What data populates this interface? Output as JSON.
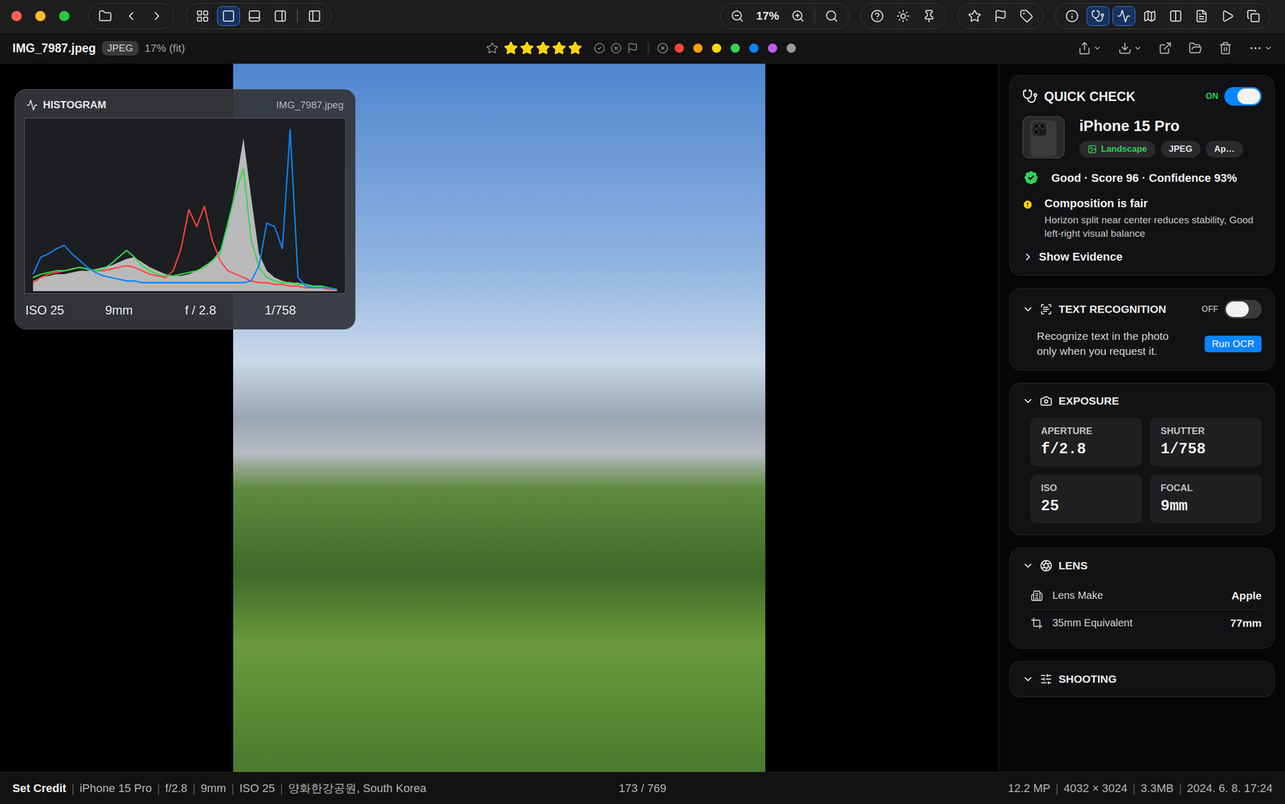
{
  "toolbar": {
    "left": [
      [
        {
          "kind": "folder",
          "selected": false
        },
        {
          "kind": "back",
          "selected": false
        },
        {
          "kind": "forward",
          "selected": false
        }
      ],
      [
        {
          "kind": "grid",
          "selected": false
        },
        {
          "kind": "single",
          "selected": true
        },
        {
          "kind": "filmstrip",
          "selected": false
        },
        {
          "kind": "compare",
          "selected": false
        },
        {
          "kind": "divider"
        },
        {
          "kind": "sidebar",
          "selected": false
        }
      ]
    ],
    "right": [
      [
        {
          "kind": "zoom-out",
          "selected": false
        },
        {
          "kind": "label",
          "label": "17%"
        },
        {
          "kind": "zoom-in",
          "selected": false
        },
        {
          "kind": "divider"
        },
        {
          "kind": "zoom-fit",
          "selected": false
        }
      ],
      [
        {
          "kind": "help",
          "selected": false
        },
        {
          "kind": "brightness",
          "selected": false
        },
        {
          "kind": "pin",
          "selected": false
        }
      ],
      [
        {
          "kind": "star",
          "selected": false
        },
        {
          "kind": "flag",
          "selected": false
        },
        {
          "kind": "tag",
          "selected": false
        }
      ],
      [
        {
          "kind": "info",
          "selected": false
        },
        {
          "kind": "quick-check",
          "selected": true
        },
        {
          "kind": "histogram",
          "selected": true
        },
        {
          "kind": "map",
          "selected": false
        },
        {
          "kind": "columns",
          "selected": false
        },
        {
          "kind": "document",
          "selected": false
        },
        {
          "kind": "play",
          "selected": false
        },
        {
          "kind": "copy",
          "selected": false
        }
      ]
    ]
  },
  "file": {
    "name": "IMG_7987.jpeg",
    "format": "JPEG",
    "zoom": "17% (fit)"
  },
  "rating": {
    "stars": 5,
    "max": 5
  },
  "flags": [
    {
      "kind": "pick",
      "selected": false
    },
    {
      "kind": "reject",
      "selected": false
    },
    {
      "kind": "flag",
      "selected": false
    }
  ],
  "color_labels": [
    {
      "name": "red",
      "color": "#ff453a",
      "selected": false
    },
    {
      "name": "orange",
      "color": "#ff9f0a",
      "selected": false
    },
    {
      "name": "yellow",
      "color": "#ffd60a",
      "selected": false
    },
    {
      "name": "green",
      "color": "#30d158",
      "selected": false
    },
    {
      "name": "blue",
      "color": "#0a84ff",
      "selected": false
    },
    {
      "name": "purple",
      "color": "#bf5af2",
      "selected": false
    },
    {
      "name": "gray",
      "color": "#98989d",
      "selected": false
    }
  ],
  "file_actions": [
    {
      "kind": "share",
      "menu": true
    },
    {
      "kind": "import",
      "menu": true
    },
    {
      "kind": "export",
      "menu": false
    },
    {
      "kind": "reveal",
      "menu": false
    },
    {
      "kind": "trash",
      "menu": false
    },
    {
      "kind": "more",
      "menu": true
    }
  ],
  "histogram": {
    "title": "HISTOGRAM",
    "file": "IMG_7987.jpeg",
    "series": [
      {
        "name": "luminance",
        "color": "#dcdcdc",
        "values": [
          6,
          8,
          9,
          10,
          10,
          11,
          12,
          12,
          13,
          14,
          15,
          17,
          19,
          20,
          17,
          14,
          12,
          10,
          9,
          9,
          10,
          12,
          15,
          18,
          24,
          38,
          62,
          90,
          55,
          22,
          12,
          8,
          6,
          5,
          5,
          4,
          3,
          3,
          2,
          1
        ]
      },
      {
        "name": "red",
        "color": "#ff453a",
        "values": [
          5,
          8,
          10,
          11,
          12,
          13,
          14,
          13,
          12,
          12,
          13,
          14,
          15,
          14,
          12,
          10,
          9,
          8,
          12,
          25,
          48,
          38,
          50,
          30,
          18,
          12,
          10,
          8,
          6,
          5,
          5,
          4,
          4,
          3,
          3,
          2,
          2,
          2,
          1,
          1
        ]
      },
      {
        "name": "green",
        "color": "#32d74b",
        "values": [
          8,
          10,
          11,
          12,
          12,
          13,
          14,
          13,
          12,
          13,
          16,
          20,
          24,
          20,
          15,
          12,
          10,
          9,
          9,
          10,
          11,
          12,
          14,
          18,
          22,
          40,
          58,
          72,
          30,
          14,
          8,
          6,
          5,
          5,
          4,
          4,
          3,
          3,
          2,
          1
        ]
      },
      {
        "name": "blue",
        "color": "#0a84ff",
        "values": [
          10,
          20,
          22,
          25,
          27,
          22,
          18,
          14,
          11,
          9,
          8,
          7,
          6,
          6,
          5,
          5,
          5,
          5,
          5,
          5,
          5,
          5,
          5,
          5,
          5,
          5,
          5,
          5,
          6,
          15,
          40,
          38,
          25,
          95,
          8,
          3,
          2,
          2,
          2,
          1
        ]
      }
    ],
    "readings": [
      "ISO 25",
      "9mm",
      "f / 2.8",
      "1/758"
    ]
  },
  "quick_check": {
    "title": "QUICK CHECK",
    "on": true,
    "state_label": "ON",
    "device": {
      "name": "iPhone 15 Pro",
      "tags": [
        {
          "label": "Landscape",
          "color": "#30d158"
        },
        {
          "label": "JPEG",
          "color": "#e5e5e5"
        },
        {
          "label": "Ap…",
          "color": "#e5e5e5"
        }
      ]
    },
    "verdict": "Good · Score 96 · Confidence 93%",
    "warning": {
      "title": "Composition is fair",
      "detail": "Horizon split near center reduces stability, Good left-right visual balance"
    },
    "evidence": {
      "label": "Show Evidence",
      "expanded": false
    }
  },
  "text_recognition": {
    "title": "TEXT RECOGNITION",
    "expanded": true,
    "on": false,
    "state_label": "OFF",
    "description": "Recognize text in the photo only when you request it.",
    "button": "Run OCR"
  },
  "exposure": {
    "title": "EXPOSURE",
    "expanded": true,
    "cells": [
      {
        "label": "APERTURE",
        "value": "f/2.8"
      },
      {
        "label": "SHUTTER",
        "value": "1/758"
      },
      {
        "label": "ISO",
        "value": "25"
      },
      {
        "label": "FOCAL",
        "value": "9mm"
      }
    ]
  },
  "lens": {
    "title": "LENS",
    "expanded": true,
    "rows": [
      {
        "kind": "make",
        "label": "Lens Make",
        "value": "Apple"
      },
      {
        "kind": "equivalent",
        "label": "35mm Equivalent",
        "value": "77mm"
      }
    ]
  },
  "shooting": {
    "title": "SHOOTING",
    "expanded": true
  },
  "status": {
    "credit": "Set Credit",
    "separator": "|",
    "left": [
      "iPhone 15 Pro",
      "f/2.8",
      "9mm",
      "ISO 25",
      "양화한강공원, South Korea"
    ],
    "counter": "173 / 769",
    "right": [
      "12.2 MP",
      "4032 × 3024",
      "3.3MB",
      "2024. 6. 8. 17:24"
    ]
  }
}
